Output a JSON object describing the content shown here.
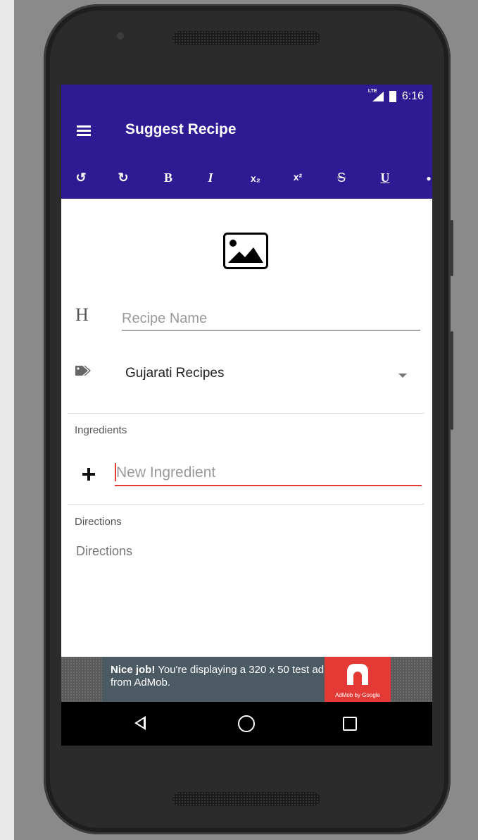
{
  "status_bar": {
    "network": "LTE",
    "time": "6:16"
  },
  "app_bar": {
    "title": "Suggest Recipe"
  },
  "toolbar": {
    "items": [
      {
        "name": "undo",
        "glyph": "↺"
      },
      {
        "name": "redo",
        "glyph": "↻"
      },
      {
        "name": "bold",
        "glyph": "B"
      },
      {
        "name": "italic",
        "glyph": "I"
      },
      {
        "name": "subscript",
        "glyph": "x₂"
      },
      {
        "name": "superscript",
        "glyph": "x²"
      },
      {
        "name": "strikethrough",
        "glyph": "S"
      },
      {
        "name": "underline",
        "glyph": "U"
      },
      {
        "name": "text-color",
        "glyph": "●"
      }
    ]
  },
  "form": {
    "image_picker_icon": "image-icon",
    "recipe_name_placeholder": "Recipe Name",
    "recipe_name_icon_glyph": "H",
    "category_value": "Gujarati Recipes",
    "ingredients_label": "Ingredients",
    "ingredient_placeholder": "New Ingredient",
    "directions_label": "Directions",
    "directions_placeholder": "Directions"
  },
  "ad": {
    "headline": "Nice job!",
    "body": " You're displaying a 320 x 50 test ad from AdMob.",
    "brand": "AdMob by Google"
  },
  "colors": {
    "primary": "#2e1a92",
    "accent_red": "#e53935"
  }
}
